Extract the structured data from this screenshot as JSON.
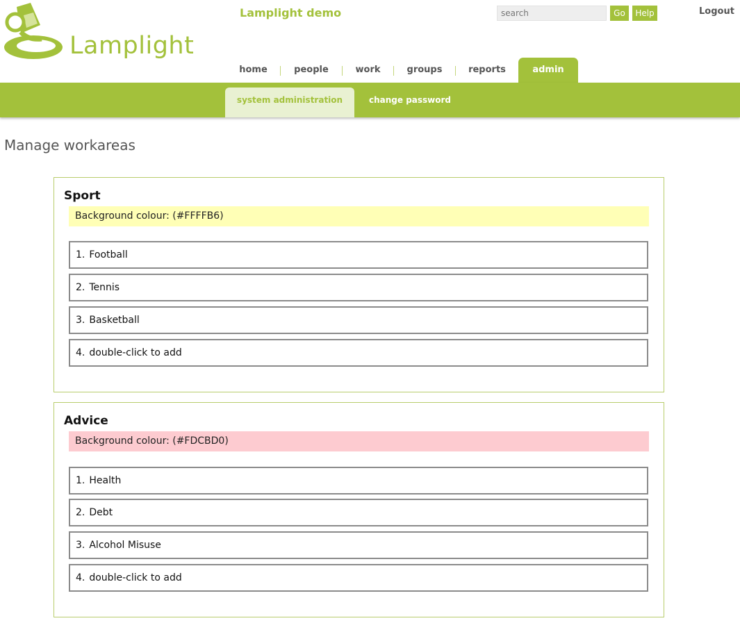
{
  "header": {
    "logo_text": "Lamplight",
    "app_title": "Lamplight demo",
    "search_placeholder": "search",
    "go_label": "Go",
    "help_label": "Help",
    "logout_label": "Logout"
  },
  "nav": {
    "home": "home",
    "people": "people",
    "work": "work",
    "groups": "groups",
    "reports": "reports",
    "admin": "admin"
  },
  "subnav": {
    "system_administration": "system administration",
    "change_password": "change password"
  },
  "page": {
    "title": "Manage workareas"
  },
  "workareas": [
    {
      "name": "Sport",
      "background_label": "Background colour: (#FFFFB6)",
      "background_color": "#FFFFB6",
      "items": [
        {
          "num": "1.",
          "label": "Football"
        },
        {
          "num": "2.",
          "label": "Tennis"
        },
        {
          "num": "3.",
          "label": "Basketball"
        },
        {
          "num": "4.",
          "label": "double-click to add"
        }
      ]
    },
    {
      "name": "Advice",
      "background_label": "Background colour: (#FDCBD0)",
      "background_color": "#FDCBD0",
      "items": [
        {
          "num": "1.",
          "label": "Health"
        },
        {
          "num": "2.",
          "label": "Debt"
        },
        {
          "num": "3.",
          "label": "Alcohol Misuse"
        },
        {
          "num": "4.",
          "label": "double-click to add"
        }
      ]
    }
  ],
  "colors": {
    "brand_green": "#a3c13b",
    "subtab_active_bg": "#e9f1d2"
  }
}
